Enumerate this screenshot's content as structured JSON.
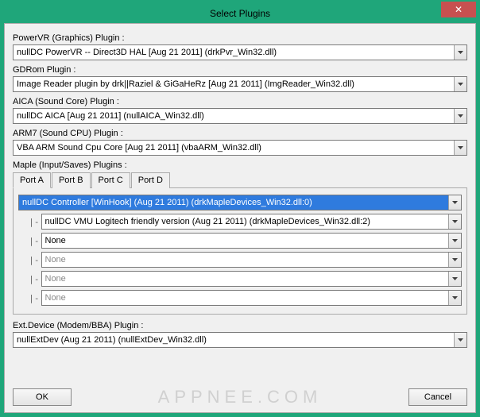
{
  "window": {
    "title": "Select Plugins",
    "close_glyph": "✕"
  },
  "sections": {
    "powervr": {
      "label": "PowerVR (Graphics) Plugin :",
      "value": "nullDC PowerVR -- Direct3D HAL [Aug 21 2011] (drkPvr_Win32.dll)"
    },
    "gdrom": {
      "label": "GDRom Plugin :",
      "value": "Image Reader plugin by drk||Raziel & GiGaHeRz [Aug 21 2011] (ImgReader_Win32.dll)"
    },
    "aica": {
      "label": "AICA (Sound Core) Plugin :",
      "value": "nullDC AICA [Aug 21 2011] (nullAICA_Win32.dll)"
    },
    "arm7": {
      "label": "ARM7 (Sound CPU) Plugin :",
      "value": "VBA ARM Sound Cpu Core [Aug 21 2011] (vbaARM_Win32.dll)"
    },
    "maple": {
      "label": "Maple (Input/Saves) Plugins :",
      "tabs": [
        "Port A",
        "Port B",
        "Port C",
        "Port D"
      ],
      "active_tab": 0,
      "slots": [
        {
          "value": "nullDC Controller [WinHook] (Aug 21 2011) (drkMapleDevices_Win32.dll:0)",
          "selected": true,
          "indent": 0,
          "enabled": true
        },
        {
          "value": "nullDC VMU Logitech friendly version (Aug 21 2011) (drkMapleDevices_Win32.dll:2)",
          "selected": false,
          "indent": 1,
          "enabled": true
        },
        {
          "value": "None",
          "selected": false,
          "indent": 1,
          "enabled": true
        },
        {
          "value": "None",
          "selected": false,
          "indent": 1,
          "enabled": false
        },
        {
          "value": "None",
          "selected": false,
          "indent": 1,
          "enabled": false
        },
        {
          "value": "None",
          "selected": false,
          "indent": 1,
          "enabled": false
        }
      ]
    },
    "extdev": {
      "label": "Ext.Device (Modem/BBA) Plugin :",
      "value": "nullExtDev (Aug 21 2011) (nullExtDev_Win32.dll)"
    }
  },
  "buttons": {
    "ok": "OK",
    "cancel": "Cancel"
  },
  "watermark": "APPNEE.COM"
}
